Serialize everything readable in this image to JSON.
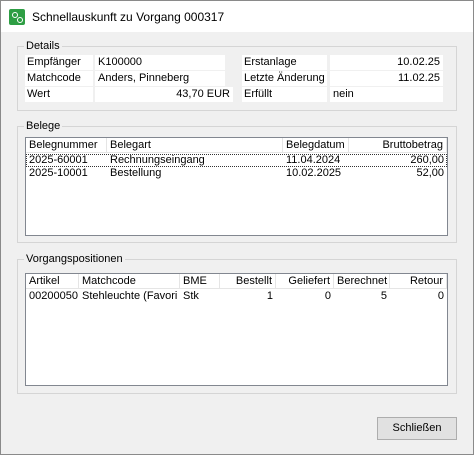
{
  "window": {
    "title": "Schnellauskunft zu Vorgang 000317"
  },
  "details": {
    "legend": "Details",
    "left": [
      {
        "label": "Empfänger",
        "value": "K100000"
      },
      {
        "label": "Matchcode",
        "value": "Anders, Pinneberg"
      },
      {
        "label": "Wert",
        "value": "43,70 EUR"
      }
    ],
    "right": [
      {
        "label": "Erstanlage",
        "value": "10.02.25"
      },
      {
        "label": "Letzte Änderung",
        "value": "11.02.25"
      },
      {
        "label": "Erfüllt",
        "value": "nein"
      }
    ]
  },
  "belege": {
    "legend": "Belege",
    "columns": [
      "Belegnummer",
      "Belegart",
      "Belegdatum",
      "Bruttobetrag"
    ],
    "rows": [
      [
        "2025-60001",
        "Rechnungseingang",
        "11.04.2024",
        "260,00"
      ],
      [
        "2025-10001",
        "Bestellung",
        "10.02.2025",
        "52,00"
      ]
    ]
  },
  "vorgangspositionen": {
    "legend": "Vorgangspositionen",
    "columns": [
      "Artikel",
      "Matchcode",
      "BME",
      "Bestellt",
      "Geliefert",
      "Berechnet",
      "Retour"
    ],
    "rows": [
      [
        "00200050",
        "Stehleuchte  (Favori",
        "Stk",
        "1",
        "0",
        "5",
        "0"
      ]
    ]
  },
  "buttons": {
    "close": "Schließen"
  }
}
